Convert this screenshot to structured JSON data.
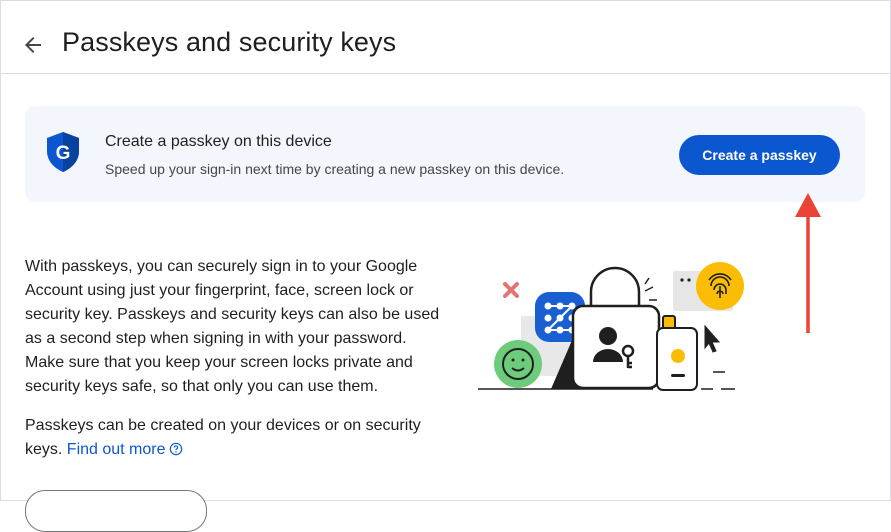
{
  "header": {
    "title": "Passkeys and security keys",
    "back_icon": "arrow-left-icon"
  },
  "banner": {
    "title": "Create a passkey on this device",
    "subtitle": "Speed up your sign-in next time by creating a new passkey on this device.",
    "button_label": "Create a passkey",
    "icon": "google-shield-icon"
  },
  "body": {
    "description": "With passkeys, you can securely sign in to your Google Account using just your fingerprint, face, screen lock or security key. Passkeys and security keys can also be used as a second step when signing in with your password. Make sure that you keep your screen locks private and security keys safe, so that only you can use them.",
    "devices_text": "Passkeys can be created on your devices or on security keys.",
    "link_label": "Find out more"
  },
  "colors": {
    "accent": "#0b57d0",
    "banner_bg": "#f3f6fc",
    "annotation": "#ea4335"
  }
}
